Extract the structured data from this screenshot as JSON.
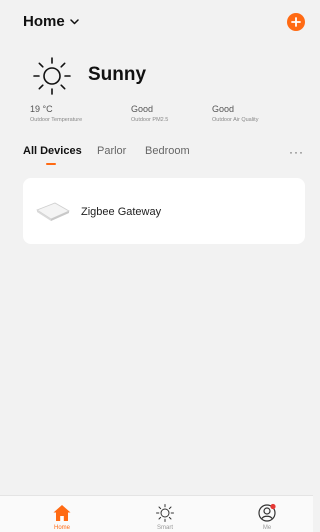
{
  "header": {
    "home_label": "Home"
  },
  "weather": {
    "condition": "Sunny",
    "icon": "sun-icon",
    "metrics": [
      {
        "value": "19 °C",
        "label": "Outdoor Temperature"
      },
      {
        "value": "Good",
        "label": "Outdoor PM2.5"
      },
      {
        "value": "Good",
        "label": "Outdoor Air Quality"
      }
    ]
  },
  "tabs": [
    {
      "label": "All Devices",
      "active": true
    },
    {
      "label": "Parlor",
      "active": false
    },
    {
      "label": "Bedroom",
      "active": false
    }
  ],
  "more_label": "···",
  "devices": [
    {
      "name": "Zigbee Gateway",
      "icon": "gateway-device-image"
    }
  ],
  "bottom_nav": [
    {
      "label": "Home",
      "icon": "home-icon",
      "active": true
    },
    {
      "label": "Smart",
      "icon": "sun-outline-icon",
      "active": false
    },
    {
      "label": "Me",
      "icon": "user-icon",
      "active": false,
      "badge": true
    }
  ],
  "colors": {
    "accent": "#ff6a13",
    "background": "#f2f2f2",
    "card": "#ffffff",
    "badge": "#e53935"
  }
}
